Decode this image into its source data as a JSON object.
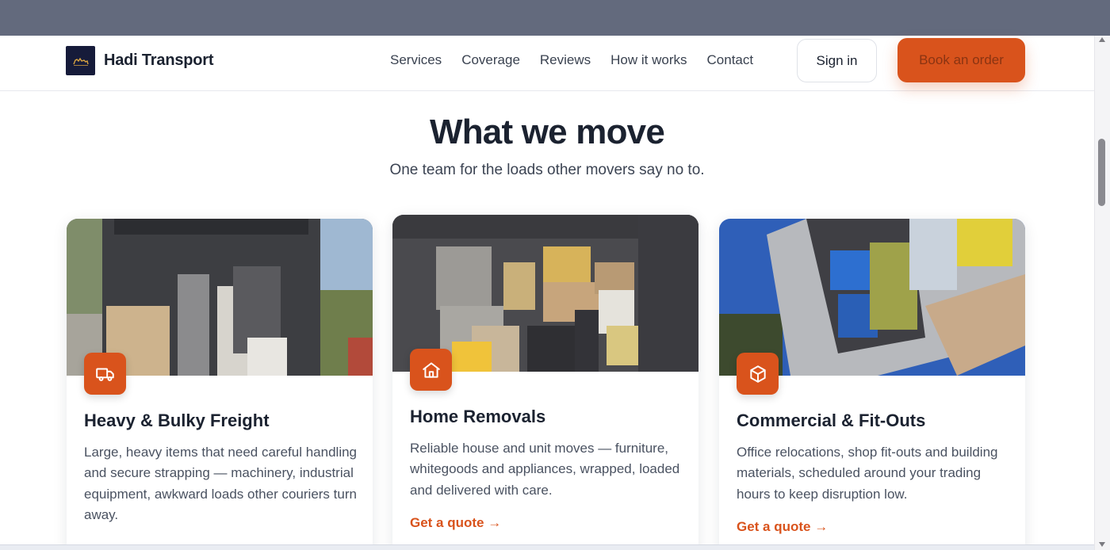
{
  "brand": {
    "name": "Hadi Transport",
    "logo_icon": "camel-logo-icon"
  },
  "nav": {
    "links": [
      "Services",
      "Coverage",
      "Reviews",
      "How it works",
      "Contact"
    ],
    "signin_label": "Sign in",
    "book_label": "Book an order"
  },
  "section": {
    "title": "What we move",
    "subtitle": "One team for the loads other movers say no to."
  },
  "cards": [
    {
      "icon": "truck-icon",
      "title": "Heavy & Bulky Freight",
      "description": "Large, heavy items that need careful handling and secure strapping — machinery, industrial equipment, awkward loads other couriers turn away.",
      "link": ""
    },
    {
      "icon": "home-icon",
      "title": "Home Removals",
      "description": "Reliable house and unit moves — furniture, whitegoods and appliances, wrapped, loaded and delivered with care.",
      "link": "Get a quote →"
    },
    {
      "icon": "box-icon",
      "title": "Commercial & Fit-Outs",
      "description": "Office relocations, shop fit-outs and building materials, scheduled around your trading hours to keep disruption low.",
      "link": "Get a quote →"
    }
  ],
  "colors": {
    "accent": "#d9531c",
    "heading": "#1b2230",
    "body_text": "#4a5261",
    "top_strip": "#636a7d"
  }
}
